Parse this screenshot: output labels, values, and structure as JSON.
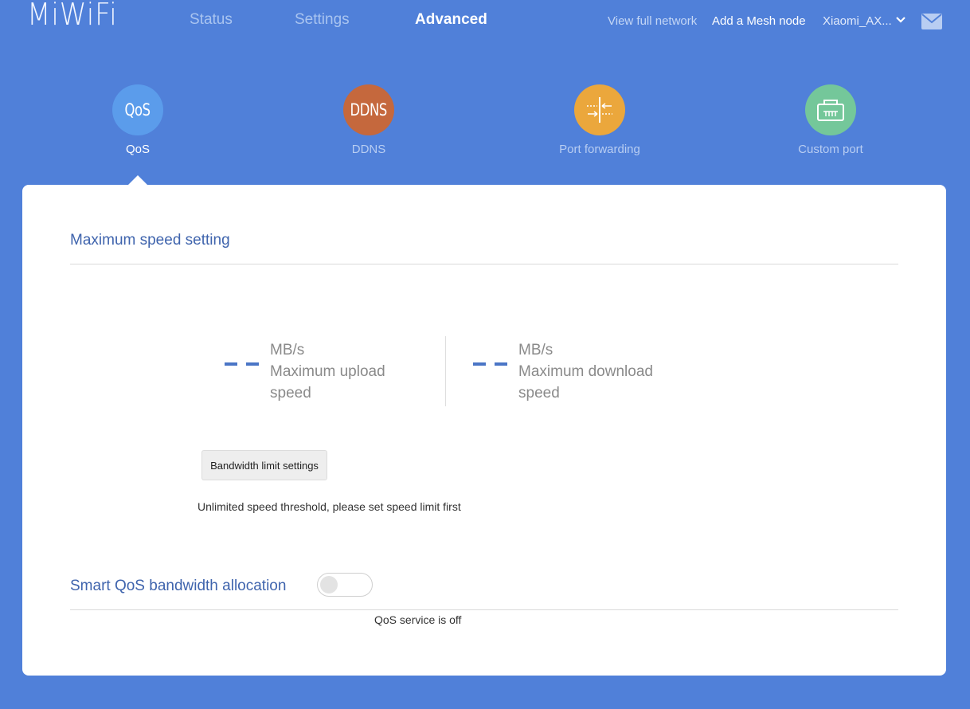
{
  "header": {
    "logo": "MiWiFi",
    "nav": [
      "Status",
      "Settings",
      "Advanced"
    ],
    "active_nav": "Advanced",
    "links": {
      "view_network": "View full network",
      "add_mesh": "Add a Mesh node",
      "device_name": "Xiaomi_AX..."
    },
    "icons": [
      "chevron-down-icon",
      "mail-icon"
    ]
  },
  "features": [
    {
      "label": "QoS",
      "icon_text": "QoS",
      "color": "#5b9ceb",
      "active": true
    },
    {
      "label": "DDNS",
      "icon_text": "DDNS",
      "color": "#c5683d",
      "active": false
    },
    {
      "label": "Port forwarding",
      "icon": "port-forward-icon",
      "color": "#eba73c",
      "active": false
    },
    {
      "label": "Custom port",
      "icon": "router-port-icon",
      "color": "#74c79a",
      "active": false
    }
  ],
  "max_speed": {
    "title": "Maximum speed setting",
    "upload": {
      "value": "- -",
      "unit": "MB/s",
      "label": "Maximum upload speed"
    },
    "download": {
      "value": "- -",
      "unit": "MB/s",
      "label": "Maximum download speed"
    },
    "button_label": "Bandwidth limit settings",
    "hint": "Unlimited speed threshold, please set speed limit first"
  },
  "smart_qos": {
    "title": "Smart QoS bandwidth allocation",
    "enabled": false,
    "status": "QoS service is off"
  },
  "colors": {
    "background": "#5080d9",
    "accent": "#3f64ad",
    "dash": "#4a75c6"
  }
}
